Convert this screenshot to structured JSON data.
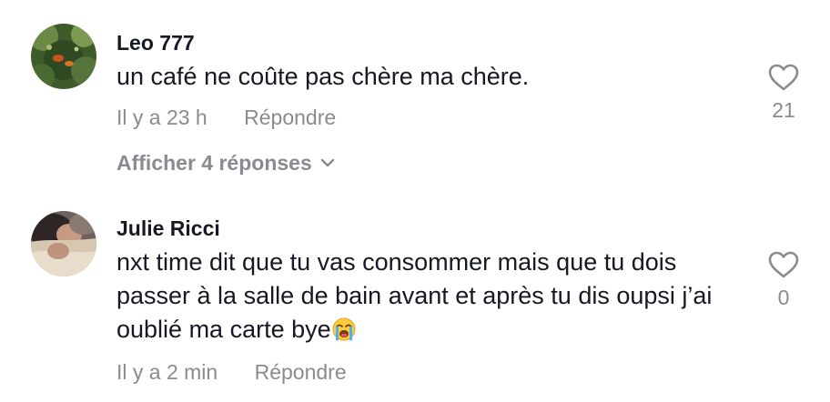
{
  "comments": [
    {
      "username": "Leo 777",
      "text": "un café ne coûte pas chère ma chère.",
      "time": "Il y a 23 h",
      "reply_label": "Répondre",
      "likes": "21",
      "view_replies": "Afficher 4 réponses"
    },
    {
      "username": "Julie Ricci",
      "text": "nxt time dit que tu vas consommer mais que tu dois passer à la salle de bain avant et après tu dis oupsi j’ai oublié ma carte bye",
      "emoji": "loudly-crying-face-emoji",
      "time": "Il y a 2 min",
      "reply_label": "Répondre",
      "likes": "0"
    }
  ],
  "icons": {
    "like": "heart-outline-icon",
    "expand": "chevron-down-icon"
  },
  "colors": {
    "primary_text": "#161823",
    "secondary_text": "#8a8b91"
  }
}
